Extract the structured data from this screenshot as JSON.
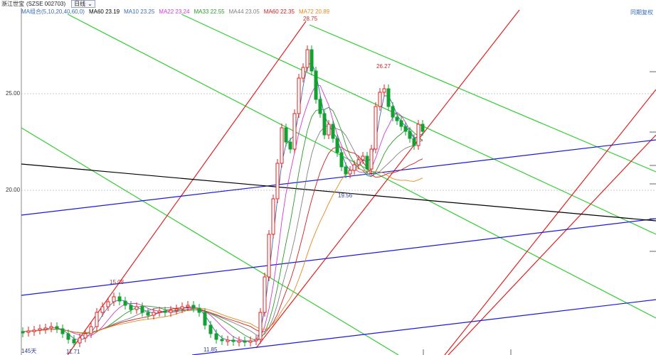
{
  "window": {
    "stock_name": "浙江世宝",
    "stock_code_label": "(SZSE 002703)",
    "period": "日线",
    "period_dropdown_icon": "chevron-down-icon"
  },
  "ma_bar": {
    "group_label": "MA组合(5,10,20,40,60,0)",
    "items": [
      {
        "label": "MA60",
        "value": "23.19",
        "color": "#000000"
      },
      {
        "label": "MA10",
        "value": "23.25",
        "color": "#3a6db5"
      },
      {
        "label": "MA22",
        "value": "23.24",
        "color": "#d03ad0"
      },
      {
        "label": "MA33",
        "value": "22.55",
        "color": "#2a9a2a"
      },
      {
        "label": "MA44",
        "value": "23.05",
        "color": "#808080"
      },
      {
        "label": "MA60",
        "value": "22.35",
        "color": "#d02020"
      },
      {
        "label": "MA72",
        "value": "20.89",
        "color": "#e08a20"
      }
    ]
  },
  "right_tag": "同期复权",
  "chart_data": {
    "type": "candlestick",
    "y_ticks": [
      "25.00",
      "20.00"
    ],
    "grid": "dashed horizontal",
    "annotations": {
      "high_peak": "28.75",
      "second_peak": "26.27",
      "left_peak": "15.08",
      "left_low": "11.71",
      "mid_low": "11.85",
      "swing_low": "19.56"
    },
    "bottom_left_label": "145天",
    "colors": {
      "up": "#e02020",
      "down": "#12a030",
      "channel_green": "#33cc33",
      "channel_red": "#e02020",
      "channel_blue": "#1a1adc",
      "black_line": "#000000"
    }
  }
}
